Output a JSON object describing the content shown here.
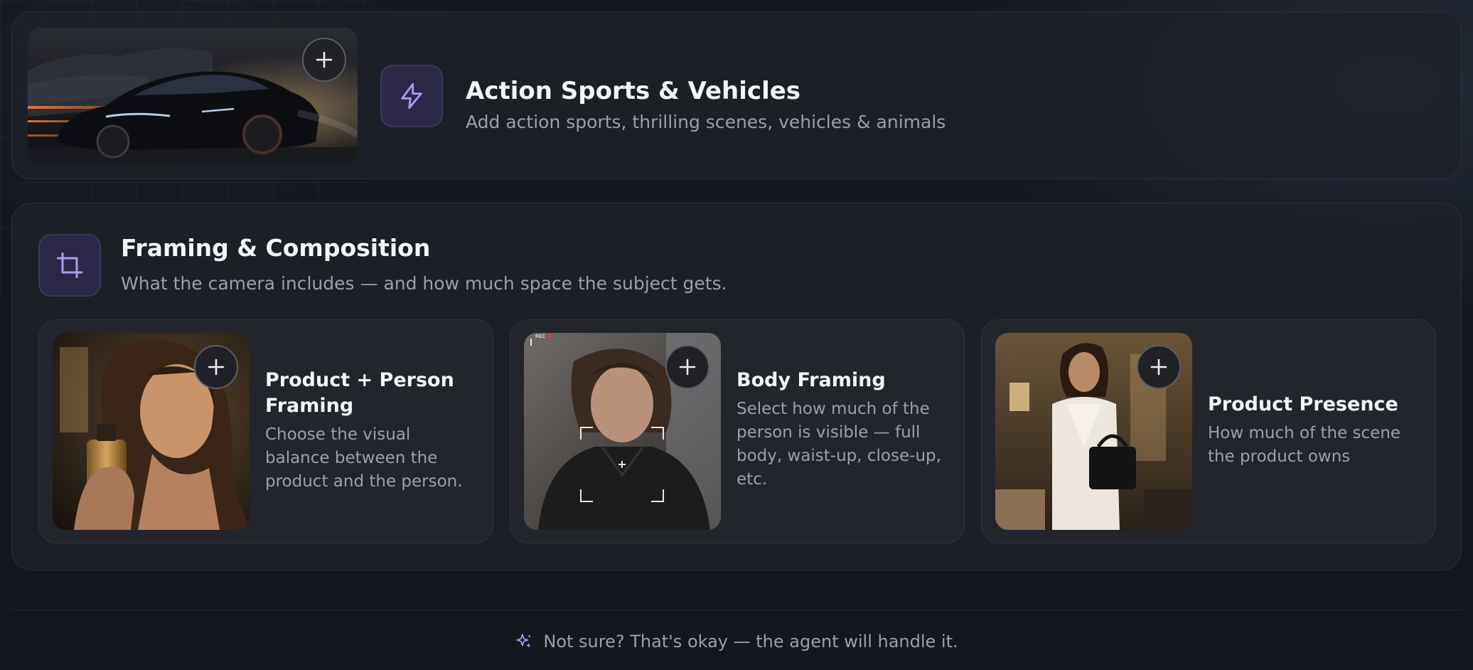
{
  "action_panel": {
    "title": "Action Sports & Vehicles",
    "subtitle": "Add action sports, thrilling scenes, vehicles & animals",
    "icon": "lightning-icon",
    "thumbnail": "sports-car-image"
  },
  "framing_panel": {
    "title": "Framing & Composition",
    "subtitle": "What the camera includes — and how much space the subject gets.",
    "icon": "crop-icon",
    "cards": [
      {
        "title": "Product + Person Framing",
        "description": "Choose the visual balance between the product and the person.",
        "thumbnail": "woman-perfume-image"
      },
      {
        "title": "Body Framing",
        "description": "Select how much of the person is visible — full body, waist-up, close-up, etc.",
        "thumbnail": "woman-camera-viewfinder-image",
        "overlay_text": "REC"
      },
      {
        "title": "Product Presence",
        "description": "How much of the scene the product owns",
        "thumbnail": "woman-handbag-image"
      }
    ]
  },
  "footer": {
    "icon": "sparkle-icon",
    "text": "Not sure? That's okay — the agent will handle it."
  },
  "colors": {
    "accent": "#a99cf0",
    "icon_tile_bg": "#2b2746",
    "background": "#14171e"
  }
}
